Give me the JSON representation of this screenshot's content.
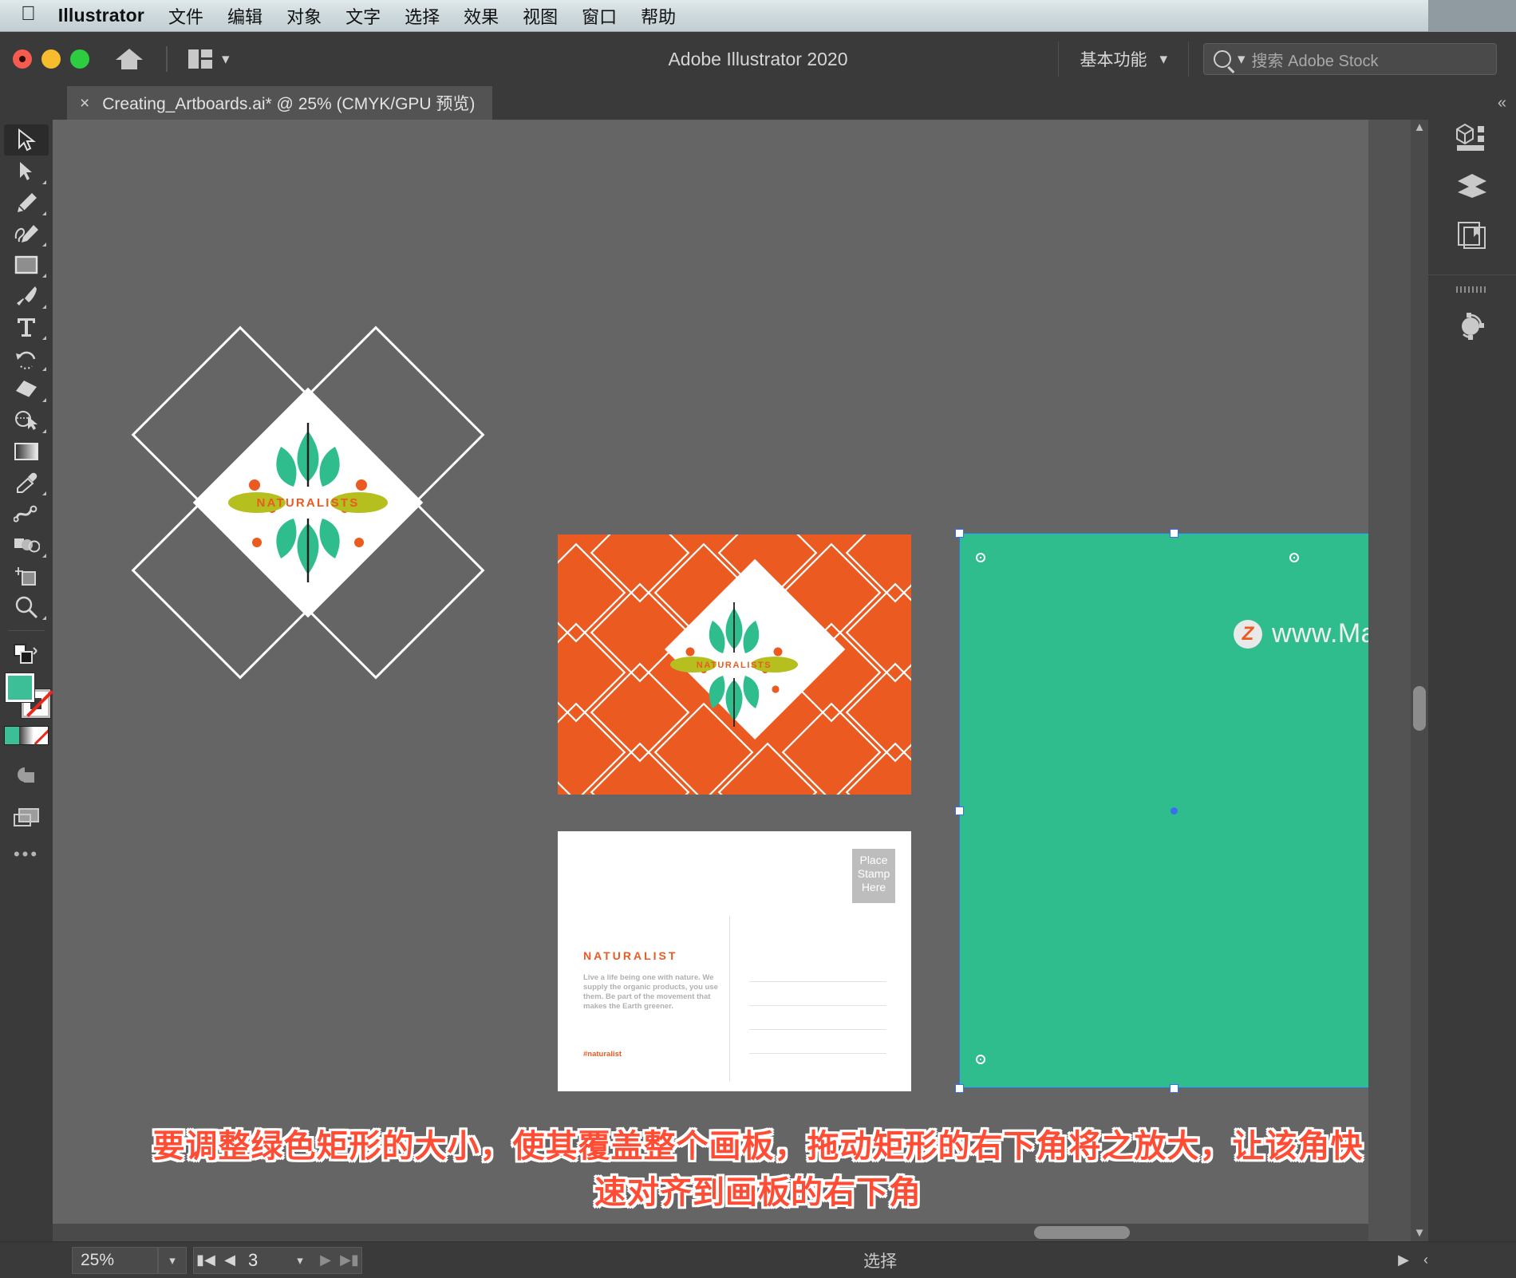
{
  "menubar": {
    "apple_icon": "apple-logo-icon",
    "app_name": "Illustrator",
    "items": [
      "文件",
      "编辑",
      "对象",
      "文字",
      "选择",
      "效果",
      "视图",
      "窗口",
      "帮助"
    ]
  },
  "header": {
    "title": "Adobe Illustrator 2020",
    "home_icon": "home-icon",
    "arrange_icon": "arrange-documents-icon",
    "arrange_chevron": "chevron-down-icon",
    "workspace": "基本功能",
    "workspace_chevron": "chevron-down-icon",
    "search": {
      "icon": "search-icon",
      "dropdown_icon": "chevron-down-icon",
      "placeholder": "搜索 Adobe Stock",
      "value": ""
    },
    "traffic_lights": [
      "close",
      "minimize",
      "zoom"
    ]
  },
  "tabbar": {
    "close_glyph": "×",
    "document_title": "Creating_Artboards.ai* @ 25% (CMYK/GPU 预览)",
    "collapse_glyph": "«"
  },
  "toolbar": {
    "expand_glyph": "»",
    "tools": [
      {
        "name": "selection-tool",
        "label": "选择工具",
        "selected": true
      },
      {
        "name": "direct-selection-tool",
        "label": "直接选择工具",
        "selected": false
      },
      {
        "name": "pen-tool",
        "label": "钢笔工具",
        "selected": false
      },
      {
        "name": "curvature-tool",
        "label": "曲率工具",
        "selected": false
      },
      {
        "name": "rectangle-tool",
        "label": "矩形工具",
        "selected": false
      },
      {
        "name": "paintbrush-tool",
        "label": "画笔工具",
        "selected": false
      },
      {
        "name": "type-tool",
        "label": "文字工具",
        "selected": false
      },
      {
        "name": "rotate-tool",
        "label": "旋转工具",
        "selected": false
      },
      {
        "name": "eraser-tool",
        "label": "橡皮擦工具",
        "selected": false
      },
      {
        "name": "shape-builder-tool",
        "label": "形状生成器工具",
        "selected": false
      },
      {
        "name": "gradient-tool",
        "label": "渐变工具",
        "selected": false
      },
      {
        "name": "eyedropper-tool",
        "label": "吸管工具",
        "selected": false
      },
      {
        "name": "blend-tool",
        "label": "混合工具",
        "selected": false
      },
      {
        "name": "symbol-sprayer-tool",
        "label": "符号喷枪工具",
        "selected": false
      },
      {
        "name": "artboard-tool",
        "label": "画板工具",
        "selected": false
      },
      {
        "name": "zoom-tool",
        "label": "缩放工具",
        "selected": false
      }
    ],
    "swap_fill_stroke_icon": "swap-fill-stroke-icon",
    "default_fill_stroke_icon": "default-fill-stroke-icon",
    "fill_color": "#3cbf96",
    "stroke_color": "none",
    "color_modes": [
      "color-swatch",
      "gradient-swatch",
      "none-swatch"
    ],
    "draw_mode_icon": "draw-mode-icon",
    "screen_mode_icon": "screen-mode-icon",
    "more_tools_glyph": "•••"
  },
  "right_panel": {
    "groups": [
      {
        "icons": [
          "properties-panel-icon",
          "layers-panel-icon",
          "libraries-panel-icon"
        ]
      },
      {
        "icons": [
          "shape-effects-panel-icon"
        ]
      }
    ]
  },
  "canvas": {
    "zoom_label": "25%",
    "artboards": [
      {
        "name": "logo-artboard",
        "kind": "logo",
        "background": "none",
        "brand": "NATURALISTS",
        "brand_color": "#ea5a21"
      },
      {
        "name": "orange-card-artboard",
        "kind": "pattern-card",
        "background": "#ea5a21",
        "brand": "NATURALISTS",
        "brand_color": "#ea5a21"
      },
      {
        "name": "postcard-artboard",
        "kind": "postcard",
        "background": "#ffffff",
        "title": "NATURALIST",
        "body": "Live a life being one with nature. We supply the organic products, you use them. Be part of the movement that makes the Earth greener.",
        "hashtag": "#naturalist",
        "stamp_lines": [
          "Place",
          "Stamp",
          "Here"
        ]
      },
      {
        "name": "green-rectangle-artboard",
        "kind": "selected-rectangle",
        "background": "#2fbd8d",
        "selected": true,
        "selection_color": "#3a6df0"
      }
    ],
    "resize_focus": {
      "name": "resize-corner-highlight",
      "color": "#f4553d",
      "cursor_icon": "resize-diagonal-cursor-icon"
    },
    "watermark": {
      "badge": "Z",
      "text": "www.MacZ.com"
    }
  },
  "caption": {
    "line1": "要调整绿色矩形的大小，使其覆盖整个画板，拖动矩形的右下角将之放大，让该角快",
    "line2": "速对齐到画板的右下角"
  },
  "statusbar": {
    "zoom_value": "25%",
    "zoom_caret": "chevron-down-icon",
    "first_artboard_icon": "first-artboard-icon",
    "prev_artboard_icon": "prev-artboard-icon",
    "artboard_number": "3",
    "artboard_caret": "chevron-down-icon",
    "next_artboard_icon": "next-artboard-icon",
    "last_artboard_icon": "last-artboard-icon",
    "status_text": "选择",
    "right_next_icon": "▶",
    "right_prev_icon": "‹"
  }
}
